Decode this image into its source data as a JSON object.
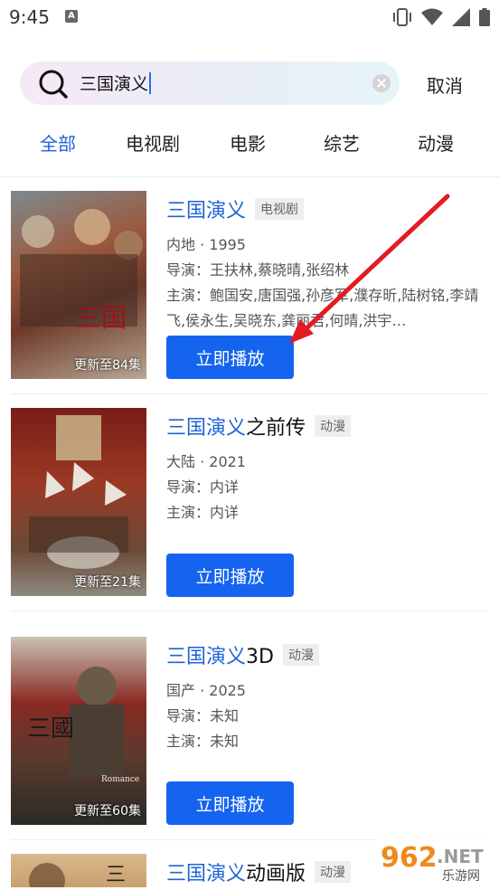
{
  "status": {
    "time": "9:45",
    "notif": "A"
  },
  "search": {
    "query": "三国演义"
  },
  "header": {
    "cancel": "取消"
  },
  "tabs": [
    "全部",
    "电视剧",
    "电影",
    "综艺",
    "动漫"
  ],
  "results": [
    {
      "title_hl": "三国演义",
      "title_rest": "",
      "type": "电视剧",
      "meta": "内地 · 1995",
      "director": "导演：王扶林,蔡晓晴,张绍林",
      "cast": "主演：鲍国安,唐国强,孙彦军,濮存昕,陆树铭,李靖飞,侯永生,吴晓东,龚丽君,何晴,洪宇…",
      "badge": "更新至84集",
      "play": "立即播放"
    },
    {
      "title_hl": "三国演义",
      "title_rest": "之前传",
      "type": "动漫",
      "meta": "大陆 · 2021",
      "director": "导演：内详",
      "cast": "主演：内详",
      "badge": "更新至21集",
      "play": "立即播放"
    },
    {
      "title_hl": "三国演义",
      "title_rest": "3D",
      "type": "动漫",
      "meta": "国产 · 2025",
      "director": "导演：未知",
      "cast": "主演：未知",
      "badge": "更新至60集",
      "play": "立即播放"
    },
    {
      "title_hl": "三国演义",
      "title_rest": "动画版",
      "type": "动漫"
    }
  ],
  "watermark": {
    "main": "962.NET",
    "sub": "乐游网"
  },
  "colors": {
    "accent": "#1e63d6",
    "button": "#1464f0",
    "arrow": "#e31b23"
  }
}
